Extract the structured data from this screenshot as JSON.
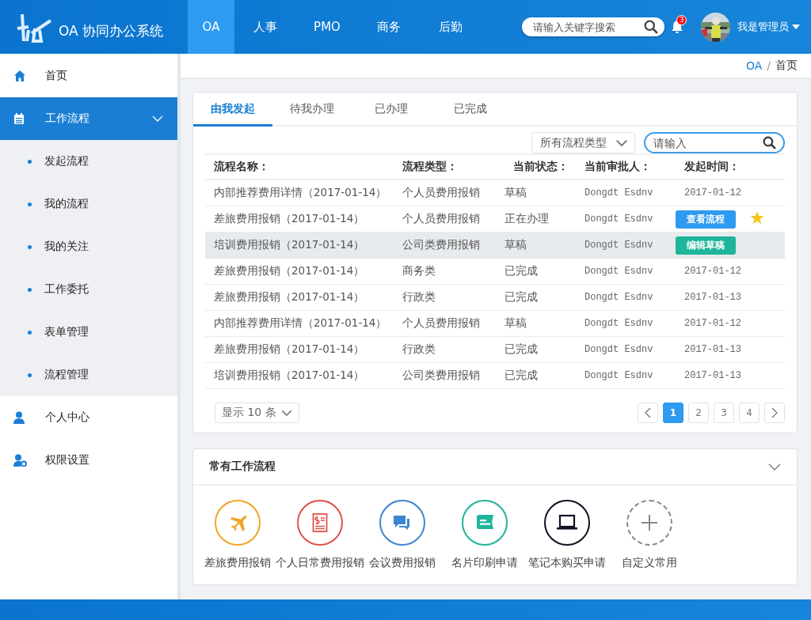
{
  "header": {
    "app_title": "OA 协同办公系统",
    "nav": [
      {
        "label": "OA",
        "selected": true
      },
      {
        "label": "人事",
        "selected": false
      },
      {
        "label": "PMO",
        "selected": false
      },
      {
        "label": "商务",
        "selected": false
      },
      {
        "label": "后勤",
        "selected": false
      }
    ],
    "search": {
      "placeholder": "请输入关键字搜索"
    },
    "notifications": "3",
    "user": "我是管理员"
  },
  "sidebar": {
    "items": [
      {
        "label": "首页",
        "selected": false
      },
      {
        "label": "工作流程",
        "selected": true,
        "expanded": true,
        "children": [
          {
            "label": "发起流程"
          },
          {
            "label": "我的流程"
          },
          {
            "label": "我的关注"
          },
          {
            "label": "工作委托"
          },
          {
            "label": "表单管理"
          },
          {
            "label": "流程管理"
          }
        ]
      },
      {
        "label": "个人中心",
        "selected": false
      },
      {
        "label": "权限设置",
        "selected": false
      }
    ]
  },
  "breadcrumb": {
    "separator": "/",
    "items": [
      {
        "label": "OA",
        "link": true
      },
      {
        "label": "首页",
        "link": false
      }
    ]
  },
  "tabs": [
    {
      "label": "由我发起",
      "selected": true
    },
    {
      "label": "待我办理",
      "selected": false
    },
    {
      "label": "已办理",
      "selected": false
    },
    {
      "label": "已完成",
      "selected": false
    }
  ],
  "filter": {
    "type_select": "所有流程类型",
    "search_placeholder": "请输入"
  },
  "table": {
    "columns": [
      "流程名称：",
      "流程类型：",
      "当前状态：",
      "当前审批人：",
      "发起时间："
    ],
    "rows": [
      {
        "name": "内部推荐费用详情（2017-01-14）",
        "type": "个人员费用报销",
        "status": "草稿",
        "approver": "Dongdt Esdnv",
        "started": "2017-01-12",
        "selected": false,
        "starred": false
      },
      {
        "name": "差旅费用报销（2017-01-14）",
        "type": "个人员费用报销",
        "status": "正在办理",
        "approver": "Dongdt Esdnv",
        "action": {
          "label": "查看流程",
          "color": "#2e9af0"
        },
        "selected": false,
        "starred": true
      },
      {
        "name": "培训费用报销（2017-01-14）",
        "type": "公司类费用报销",
        "status": "草稿",
        "approver": "Dongdt Esdnv",
        "action": {
          "label": "编辑草稿",
          "color": "#1fb59a"
        },
        "selected": true,
        "starred": false
      },
      {
        "name": "差旅费用报销（2017-01-14）",
        "type": "商务类",
        "status": "已完成",
        "approver": "Dongdt Esdnv",
        "started": "2017-01-12",
        "selected": false,
        "starred": false
      },
      {
        "name": "差旅费用报销（2017-01-14）",
        "type": "行政类",
        "status": "已完成",
        "approver": "Dongdt Esdnv",
        "started": "2017-01-13",
        "selected": false,
        "starred": false
      },
      {
        "name": "内部推荐费用详情（2017-01-14）",
        "type": "个人员费用报销",
        "status": "草稿",
        "approver": "Dongdt Esdnv",
        "started": "2017-01-12",
        "selected": false,
        "starred": false
      },
      {
        "name": "差旅费用报销（2017-01-14）",
        "type": "行政类",
        "status": "已完成",
        "approver": "Dongdt Esdnv",
        "started": "2017-01-13",
        "selected": false,
        "starred": false
      },
      {
        "name": "培训费用报销（2017-01-14）",
        "type": "公司类费用报销",
        "status": "已完成",
        "approver": "Dongdt Esdnv",
        "started": "2017-01-13",
        "selected": false,
        "starred": false
      }
    ]
  },
  "page_size": "显示 10 条",
  "pagination": [
    {
      "label": "1",
      "selected": true
    },
    {
      "label": "2",
      "selected": false
    },
    {
      "label": "3",
      "selected": false
    },
    {
      "label": "4",
      "selected": false
    }
  ],
  "shortcuts": {
    "title": "常有工作流程",
    "expanded": true,
    "items": [
      {
        "label": "差旅费用报销",
        "kind": "plane",
        "color": "#f0a526"
      },
      {
        "label": "个人日常费用报销",
        "kind": "receipt",
        "color": "#e0524a"
      },
      {
        "label": "会议费用报销",
        "kind": "chat",
        "color": "#3d86cf"
      },
      {
        "label": "名片印刷申请",
        "kind": "card",
        "color": "#1fb59a"
      },
      {
        "label": "笔记本购买申请",
        "kind": "laptop",
        "color": "#111122"
      },
      {
        "label": "自定义常用",
        "kind": "add",
        "color": "#888888"
      }
    ]
  }
}
